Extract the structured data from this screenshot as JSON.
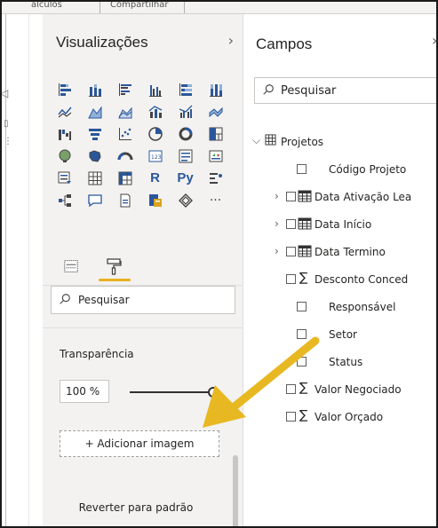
{
  "topbar": {
    "left_text": "alculos",
    "mid_text": "Compartilhar"
  },
  "visualizations": {
    "title": "Visualizações",
    "collapse_icon": "chevron-right-icon",
    "icon_rows": [
      [
        "stacked-bar-icon",
        "stacked-column-icon",
        "clustered-bar-icon",
        "clustered-column-icon",
        "100-bar-icon",
        "100-column-icon"
      ],
      [
        "line-chart-icon",
        "area-chart-icon",
        "stacked-area-icon",
        "line-column-icon",
        "line-clustered-icon",
        "ribbon-chart-icon"
      ],
      [
        "waterfall-icon",
        "funnel-icon",
        "scatter-icon",
        "pie-icon",
        "donut-icon",
        "treemap-icon"
      ],
      [
        "map-icon",
        "filled-map-icon",
        "gauge-icon",
        "card-icon",
        "multirow-card-icon",
        "kpi-icon"
      ],
      [
        "slicer-icon",
        "table-icon",
        "matrix-icon",
        "r-visual-icon",
        "python-visual-icon",
        "key-influencers-icon"
      ],
      [
        "decomposition-tree-icon",
        "qa-icon",
        "smart-narrative-icon",
        "paginated-icon",
        "power-apps-icon",
        "more-icon"
      ]
    ],
    "r_label": "R",
    "py_label": "Py",
    "more_label": "···",
    "tabs": [
      {
        "icon": "fields-tab-icon"
      },
      {
        "icon": "format-paint-roller-icon",
        "active": true
      }
    ],
    "search_placeholder": "Pesquisar",
    "transparency_label": "Transparência",
    "transparency_value": "100 %",
    "transparency_slider": 100,
    "add_image_label": "+ Adicionar imagem",
    "reset_label": "Reverter para padrão"
  },
  "fields": {
    "title": "Campos",
    "search_placeholder": "Pesquisar",
    "table_name": "Projetos",
    "items": [
      {
        "label": "Código Projeto",
        "type": "text"
      },
      {
        "label": "Data Ativação Lea",
        "type": "date",
        "expandable": true
      },
      {
        "label": "Data Início",
        "type": "date",
        "expandable": true
      },
      {
        "label": "Data Termino",
        "type": "date",
        "expandable": true
      },
      {
        "label": "Desconto Conced",
        "type": "sum"
      },
      {
        "label": "Responsável",
        "type": "text"
      },
      {
        "label": "Setor",
        "type": "text"
      },
      {
        "label": "Status",
        "type": "text"
      },
      {
        "label": "Valor Negociado",
        "type": "sum"
      },
      {
        "label": "Valor Orçado",
        "type": "sum"
      }
    ]
  },
  "colors": {
    "accent": "#e8b11f",
    "arrow": "#e8b822",
    "pane_bg": "#f3f2f1"
  }
}
